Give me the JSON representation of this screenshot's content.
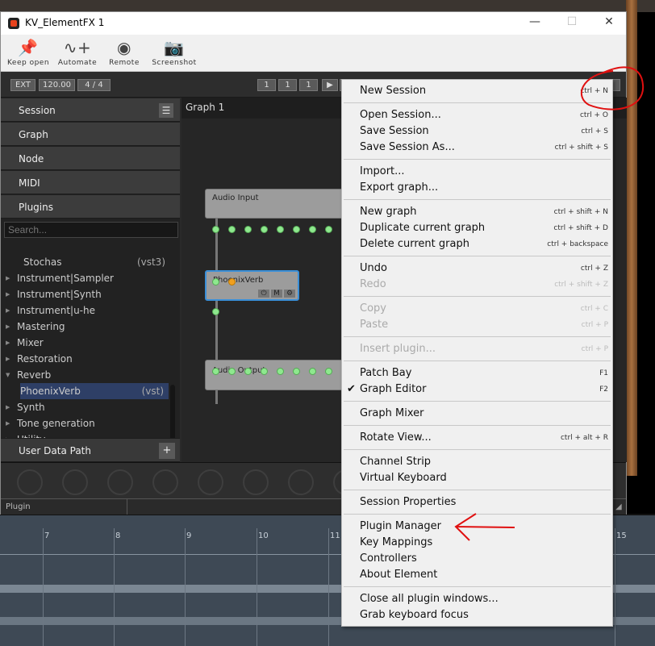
{
  "window": {
    "title": "KV_ElementFX 1",
    "minimize": "—",
    "maximize": "☐",
    "close": "✕"
  },
  "toolbar": [
    {
      "label": "Keep open",
      "icon": "pin-icon",
      "glyph": "📌"
    },
    {
      "label": "Automate",
      "icon": "automate-icon",
      "glyph": "∿+"
    },
    {
      "label": "Remote",
      "icon": "remote-icon",
      "glyph": "◉"
    },
    {
      "label": "Screenshot",
      "icon": "camera-icon",
      "glyph": "📷"
    }
  ],
  "transport": {
    "sync": "EXT",
    "tempo": "120.00",
    "meter": "4 / 4",
    "bars": "1",
    "beats": "1",
    "ticks": "1",
    "play": "▶"
  },
  "sidebar": {
    "sections": [
      "Session",
      "Graph",
      "Node",
      "MIDI",
      "Plugins"
    ],
    "search_placeholder": "Search...",
    "items": [
      {
        "label": "Stochas",
        "format": "(vst3)",
        "arrow": ""
      },
      {
        "label": "Instrument|Sampler",
        "arrow": "▶"
      },
      {
        "label": "Instrument|Synth",
        "arrow": "▶"
      },
      {
        "label": "Instrument|u-he",
        "arrow": "▶"
      },
      {
        "label": "Mastering",
        "arrow": "▶"
      },
      {
        "label": "Mixer",
        "arrow": "▶"
      },
      {
        "label": "Restoration",
        "arrow": "▶"
      },
      {
        "label": "Reverb",
        "arrow": "▼"
      },
      {
        "label": "PhoenixVerb",
        "format": "(vst)",
        "arrow": "",
        "selected": true
      },
      {
        "label": "Synth",
        "arrow": "▶"
      },
      {
        "label": "Tone generation",
        "arrow": "▶"
      },
      {
        "label": "Utility",
        "arrow": "▶"
      }
    ],
    "user_data_path": "User Data Path",
    "add": "+"
  },
  "graph": {
    "tab": "Graph 1",
    "nodes": {
      "input": "Audio Input",
      "plugin": "PhoenixVerb",
      "output": "Audio Output"
    },
    "node_buttons": {
      "power": "⏻",
      "mute": "M",
      "settings": "⚙"
    }
  },
  "status": {
    "label": "Plugin"
  },
  "ruler": [
    "7",
    "8",
    "9",
    "10",
    "11",
    "15"
  ],
  "menu": [
    {
      "label": "New Session",
      "key": "ctrl + N"
    },
    {
      "sep": true
    },
    {
      "label": "Open Session...",
      "key": "ctrl + O"
    },
    {
      "label": "Save Session",
      "key": "ctrl + S"
    },
    {
      "label": "Save Session As...",
      "key": "ctrl + shift + S"
    },
    {
      "sep": true
    },
    {
      "label": "Import..."
    },
    {
      "label": "Export graph..."
    },
    {
      "sep": true
    },
    {
      "label": "New graph",
      "key": "ctrl + shift + N"
    },
    {
      "label": "Duplicate current graph",
      "key": "ctrl + shift + D"
    },
    {
      "label": "Delete current graph",
      "key": "ctrl + backspace"
    },
    {
      "sep": true
    },
    {
      "label": "Undo",
      "key": "ctrl + Z"
    },
    {
      "label": "Redo",
      "key": "ctrl + shift + Z",
      "disabled": true
    },
    {
      "sep": true
    },
    {
      "label": "Copy",
      "key": "ctrl + C",
      "disabled": true
    },
    {
      "label": "Paste",
      "key": "ctrl + P",
      "disabled": true
    },
    {
      "sep": true
    },
    {
      "label": "Insert plugin...",
      "key": "ctrl + P",
      "disabled": true
    },
    {
      "sep": true
    },
    {
      "label": "Patch Bay",
      "key": "F1"
    },
    {
      "label": "Graph Editor",
      "key": "F2",
      "checked": true,
      "check": "✔"
    },
    {
      "sep": true
    },
    {
      "label": "Graph Mixer"
    },
    {
      "sep": true
    },
    {
      "label": "Rotate View...",
      "key": "ctrl + alt + R"
    },
    {
      "sep": true
    },
    {
      "label": "Channel Strip"
    },
    {
      "label": "Virtual Keyboard"
    },
    {
      "sep": true
    },
    {
      "label": "Session Properties"
    },
    {
      "sep": true
    },
    {
      "label": "Plugin Manager"
    },
    {
      "label": "Key Mappings"
    },
    {
      "label": "Controllers"
    },
    {
      "label": "About Element"
    },
    {
      "sep": true
    },
    {
      "label": "Close all plugin windows..."
    },
    {
      "label": "Grab keyboard focus"
    }
  ],
  "colors": {
    "annotation": "#e01010",
    "selection": "#2e3f66",
    "port": "#8ee88e",
    "port_active": "#f0a020",
    "node_border_selected": "#3a8fd8"
  }
}
